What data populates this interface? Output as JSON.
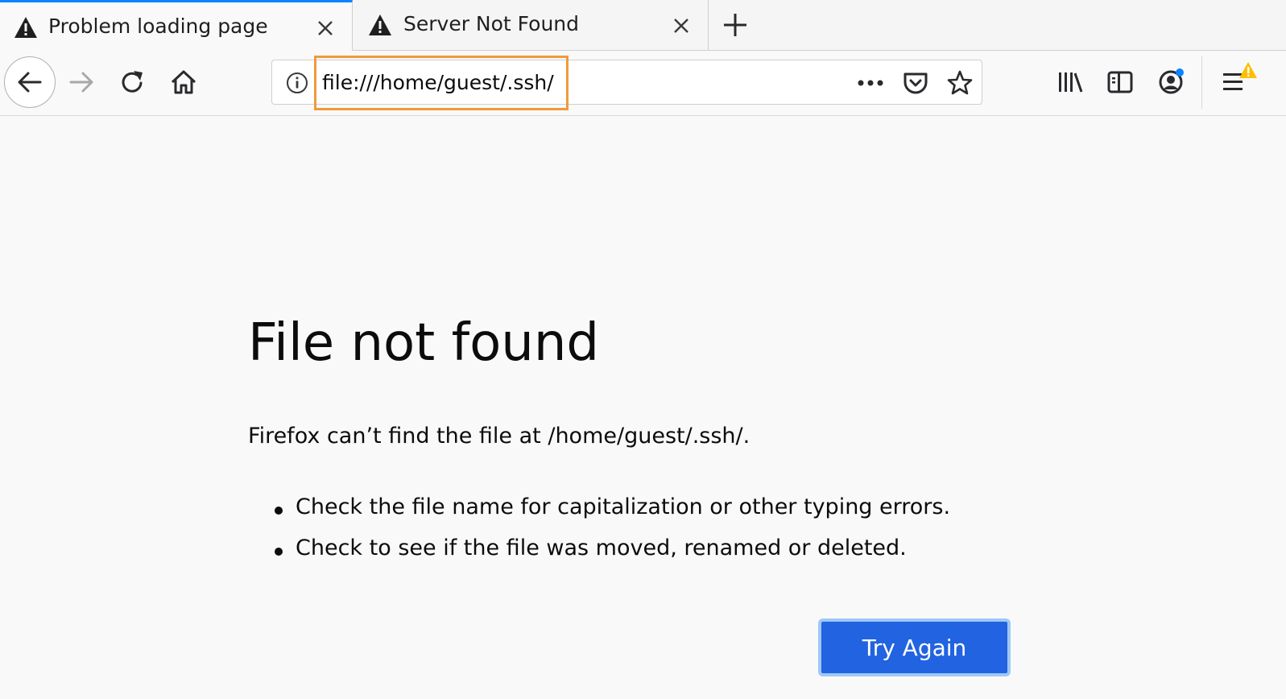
{
  "tabs": [
    {
      "title": "Problem loading page",
      "active": true,
      "icon": "warning-icon"
    },
    {
      "title": "Server Not Found",
      "active": false,
      "icon": "warning-icon"
    }
  ],
  "urlbar": {
    "value": "file:///home/guest/.ssh/"
  },
  "toolbar": {
    "icons": [
      "back-icon",
      "forward-icon",
      "reload-icon",
      "home-icon",
      "info-icon",
      "page-actions-icon",
      "pocket-icon",
      "bookmark-star-icon",
      "library-icon",
      "sidebar-icon",
      "account-icon",
      "menu-icon"
    ]
  },
  "error": {
    "title": "File not found",
    "description": "Firefox can’t find the file at /home/guest/.ssh/.",
    "suggestions": [
      "Check the file name for capitalization or other typing errors.",
      "Check to see if the file was moved, renamed or deleted."
    ],
    "button_label": "Try Again"
  },
  "colors": {
    "accent": "#0a84ff",
    "button": "#2163e0",
    "url_highlight": "#ef9a3c",
    "menu_warning": "#ffbf00"
  }
}
